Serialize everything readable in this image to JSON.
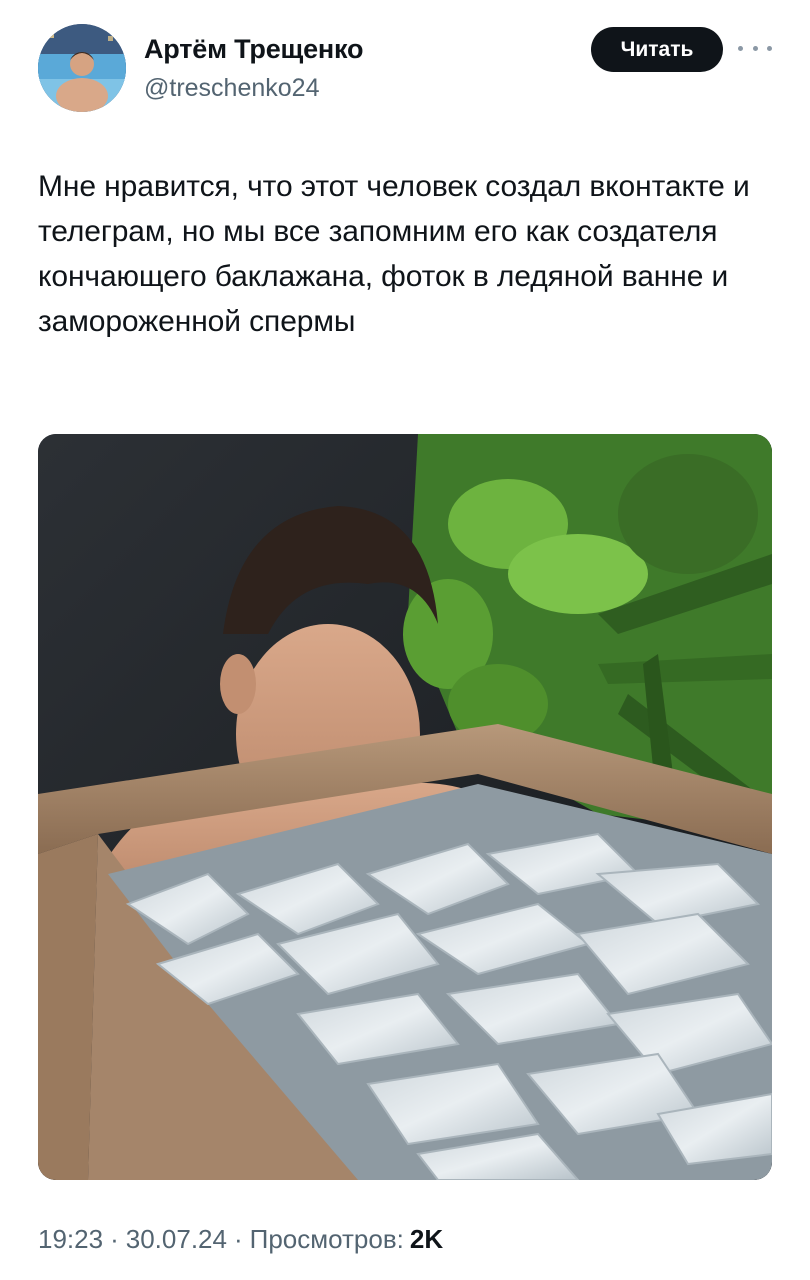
{
  "author": {
    "name": "Артём Трещенко",
    "handle": "@treschenko24"
  },
  "follow_label": "Читать",
  "tweet": {
    "text": "Мне нравится, что этот человек создал вконтакте и телеграм, но мы все запомним его как создателя кончающего баклажана, фоток в ледяной ванне и замороженной спермы"
  },
  "meta": {
    "time": "19:23",
    "date": "30.07.24",
    "views_label": "Просмотров:",
    "views_count": "2K"
  },
  "colors": {
    "follow_button": "#0f1419",
    "secondary_text": "#536471"
  }
}
